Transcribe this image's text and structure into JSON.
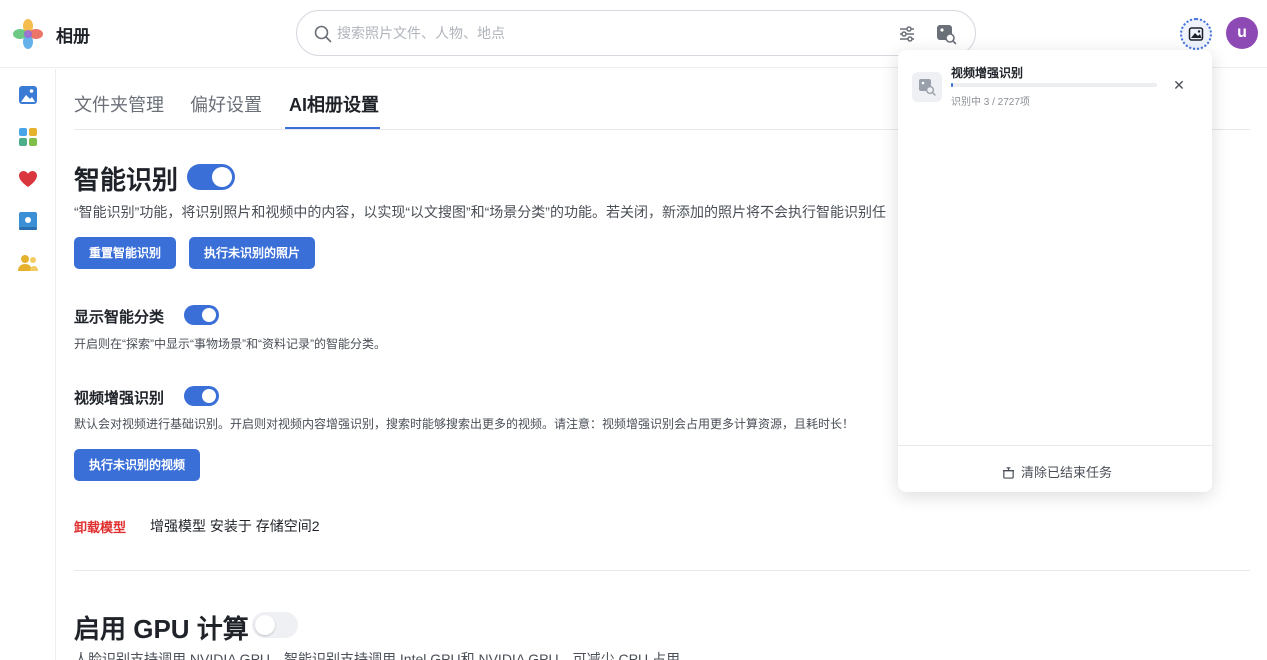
{
  "app": {
    "name": "相册",
    "logo": "photos-flower-logo"
  },
  "search": {
    "placeholder": "搜索照片文件、人物、地点",
    "value": "",
    "icons": [
      "search-icon",
      "filter-icon",
      "image-search-icon"
    ]
  },
  "header": {
    "task_icon": "image-icon",
    "avatar_letter": "u",
    "avatar_color": "#8d49b4"
  },
  "sidebar": {
    "items": [
      {
        "name": "photos",
        "icon": "image-icon",
        "color": "#3a7bd5"
      },
      {
        "name": "albums",
        "icon": "grid-icon",
        "color": "#4caf8a"
      },
      {
        "name": "favorites",
        "icon": "heart-icon",
        "color": "#d9363e"
      },
      {
        "name": "shared",
        "icon": "shared-album-icon",
        "color": "#3a8fd5"
      },
      {
        "name": "people",
        "icon": "people-icon",
        "color": "#e6b12d"
      }
    ]
  },
  "tabs": [
    {
      "label": "文件夹管理",
      "active": false
    },
    {
      "label": "偏好设置",
      "active": false
    },
    {
      "label": "AI相册设置",
      "active": true
    }
  ],
  "smart_recognition": {
    "title": "智能识别",
    "enabled": true,
    "description": "“智能识别”功能，将识别照片和视频中的内容，以实现“以文搜图”和“场景分类”的功能。若关闭，新添加的照片将不会执行智能识别任",
    "buttons": [
      "重置智能识别",
      "执行未识别的照片"
    ]
  },
  "smart_category": {
    "title": "显示智能分类",
    "enabled": true,
    "description": "开启则在“探索”中显示“事物场景”和“资料记录”的智能分类。"
  },
  "video_enhance": {
    "title": "视频增强识别",
    "enabled": true,
    "description": "默认会对视频进行基础识别。开启则对视频内容增强识别，搜索时能够搜索出更多的视频。请注意：视频增强识别会占用更多计算资源，且耗时长！",
    "button": "执行未识别的视频"
  },
  "model": {
    "uninstall_label": "卸载模型",
    "info": "增强模型 安装于 存储空间2"
  },
  "gpu": {
    "title": "启用 GPU 计算",
    "enabled": false,
    "description": "人脸识别支持调用 NVIDIA GPU，智能识别支持调用 Intel GPU和 NVIDIA GPU，可减少 CPU 占用"
  },
  "task_panel": {
    "task_title": "视频增强识别",
    "status": "识别中 3 / 2727项",
    "progress_fraction": 0.0011,
    "clear_label": "清除已结束任务"
  },
  "colors": {
    "accent": "#3a6fd8",
    "danger": "#e02f2f"
  }
}
